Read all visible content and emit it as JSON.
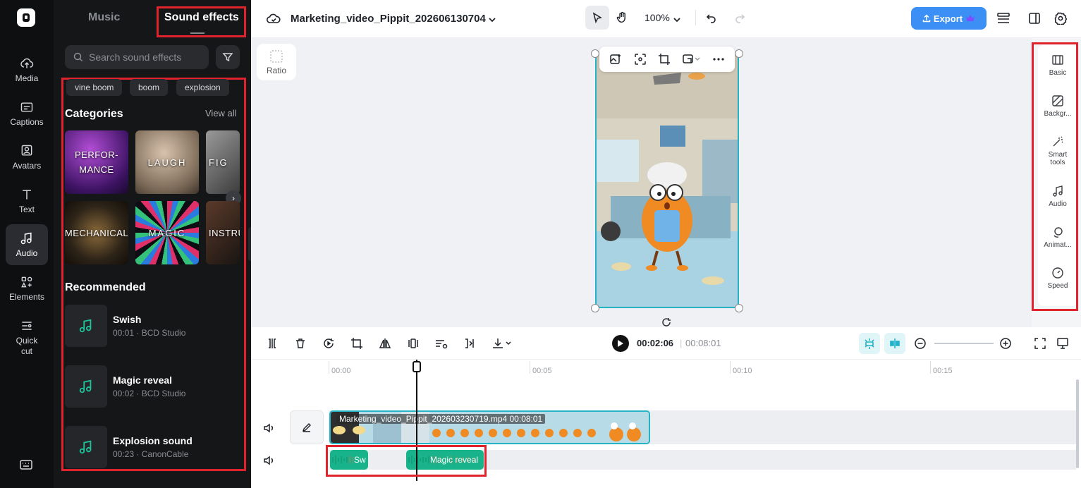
{
  "rail": {
    "items": [
      {
        "label": "Media",
        "icon": "cloud-upload-icon"
      },
      {
        "label": "Captions",
        "icon": "captions-icon"
      },
      {
        "label": "Avatars",
        "icon": "avatar-icon"
      },
      {
        "label": "Text",
        "icon": "text-icon"
      },
      {
        "label": "Audio",
        "icon": "music-note-icon",
        "active": true
      },
      {
        "label": "Elements",
        "icon": "elements-icon"
      },
      {
        "label": "Quick\ncut",
        "icon": "quick-cut-icon"
      }
    ]
  },
  "panel": {
    "tabs": {
      "music": "Music",
      "sound_effects": "Sound effects"
    },
    "search_placeholder": "Search sound effects",
    "chips": [
      "vine boom",
      "boom",
      "explosion"
    ],
    "categories_title": "Categories",
    "view_all": "View all",
    "categories": [
      {
        "label": "PERFOR-\nMANCE"
      },
      {
        "label": "LAUGH"
      },
      {
        "label": "FIG"
      },
      {
        "label": "MECHANICAL"
      },
      {
        "label": "MAGIC"
      },
      {
        "label": "INSTRU"
      }
    ],
    "recommended_title": "Recommended",
    "recommended": [
      {
        "title": "Swish",
        "meta": "00:01 · BCD Studio"
      },
      {
        "title": "Magic reveal",
        "meta": "00:02 · BCD Studio"
      },
      {
        "title": "Explosion sound",
        "meta": "00:23 · CanonCable"
      }
    ]
  },
  "header": {
    "project_title": "Marketing_video_Pippit_202606130704",
    "zoom": "100%",
    "export_label": "Export"
  },
  "canvas": {
    "ratio_label": "Ratio"
  },
  "right_panel": {
    "items": [
      "Basic",
      "Backgr...",
      "Smart\ntools",
      "Audio",
      "Animat...",
      "Speed"
    ]
  },
  "playback": {
    "current_time": "00:02:06",
    "separator": "|",
    "total_time": "00:08:01"
  },
  "timeline": {
    "ticks": [
      "00:00",
      "00:05",
      "00:10",
      "00:15"
    ],
    "video_clip_label": "Marketing_video_Pippit_202603230719.mp4  00:08:01",
    "audio_clips": [
      "Sw",
      "Magic reveal"
    ]
  },
  "colors": {
    "accent": "#3b8ff5",
    "selection": "#26b3c5",
    "audio_clip": "#19b38b",
    "annotation_red": "#e0232d"
  }
}
